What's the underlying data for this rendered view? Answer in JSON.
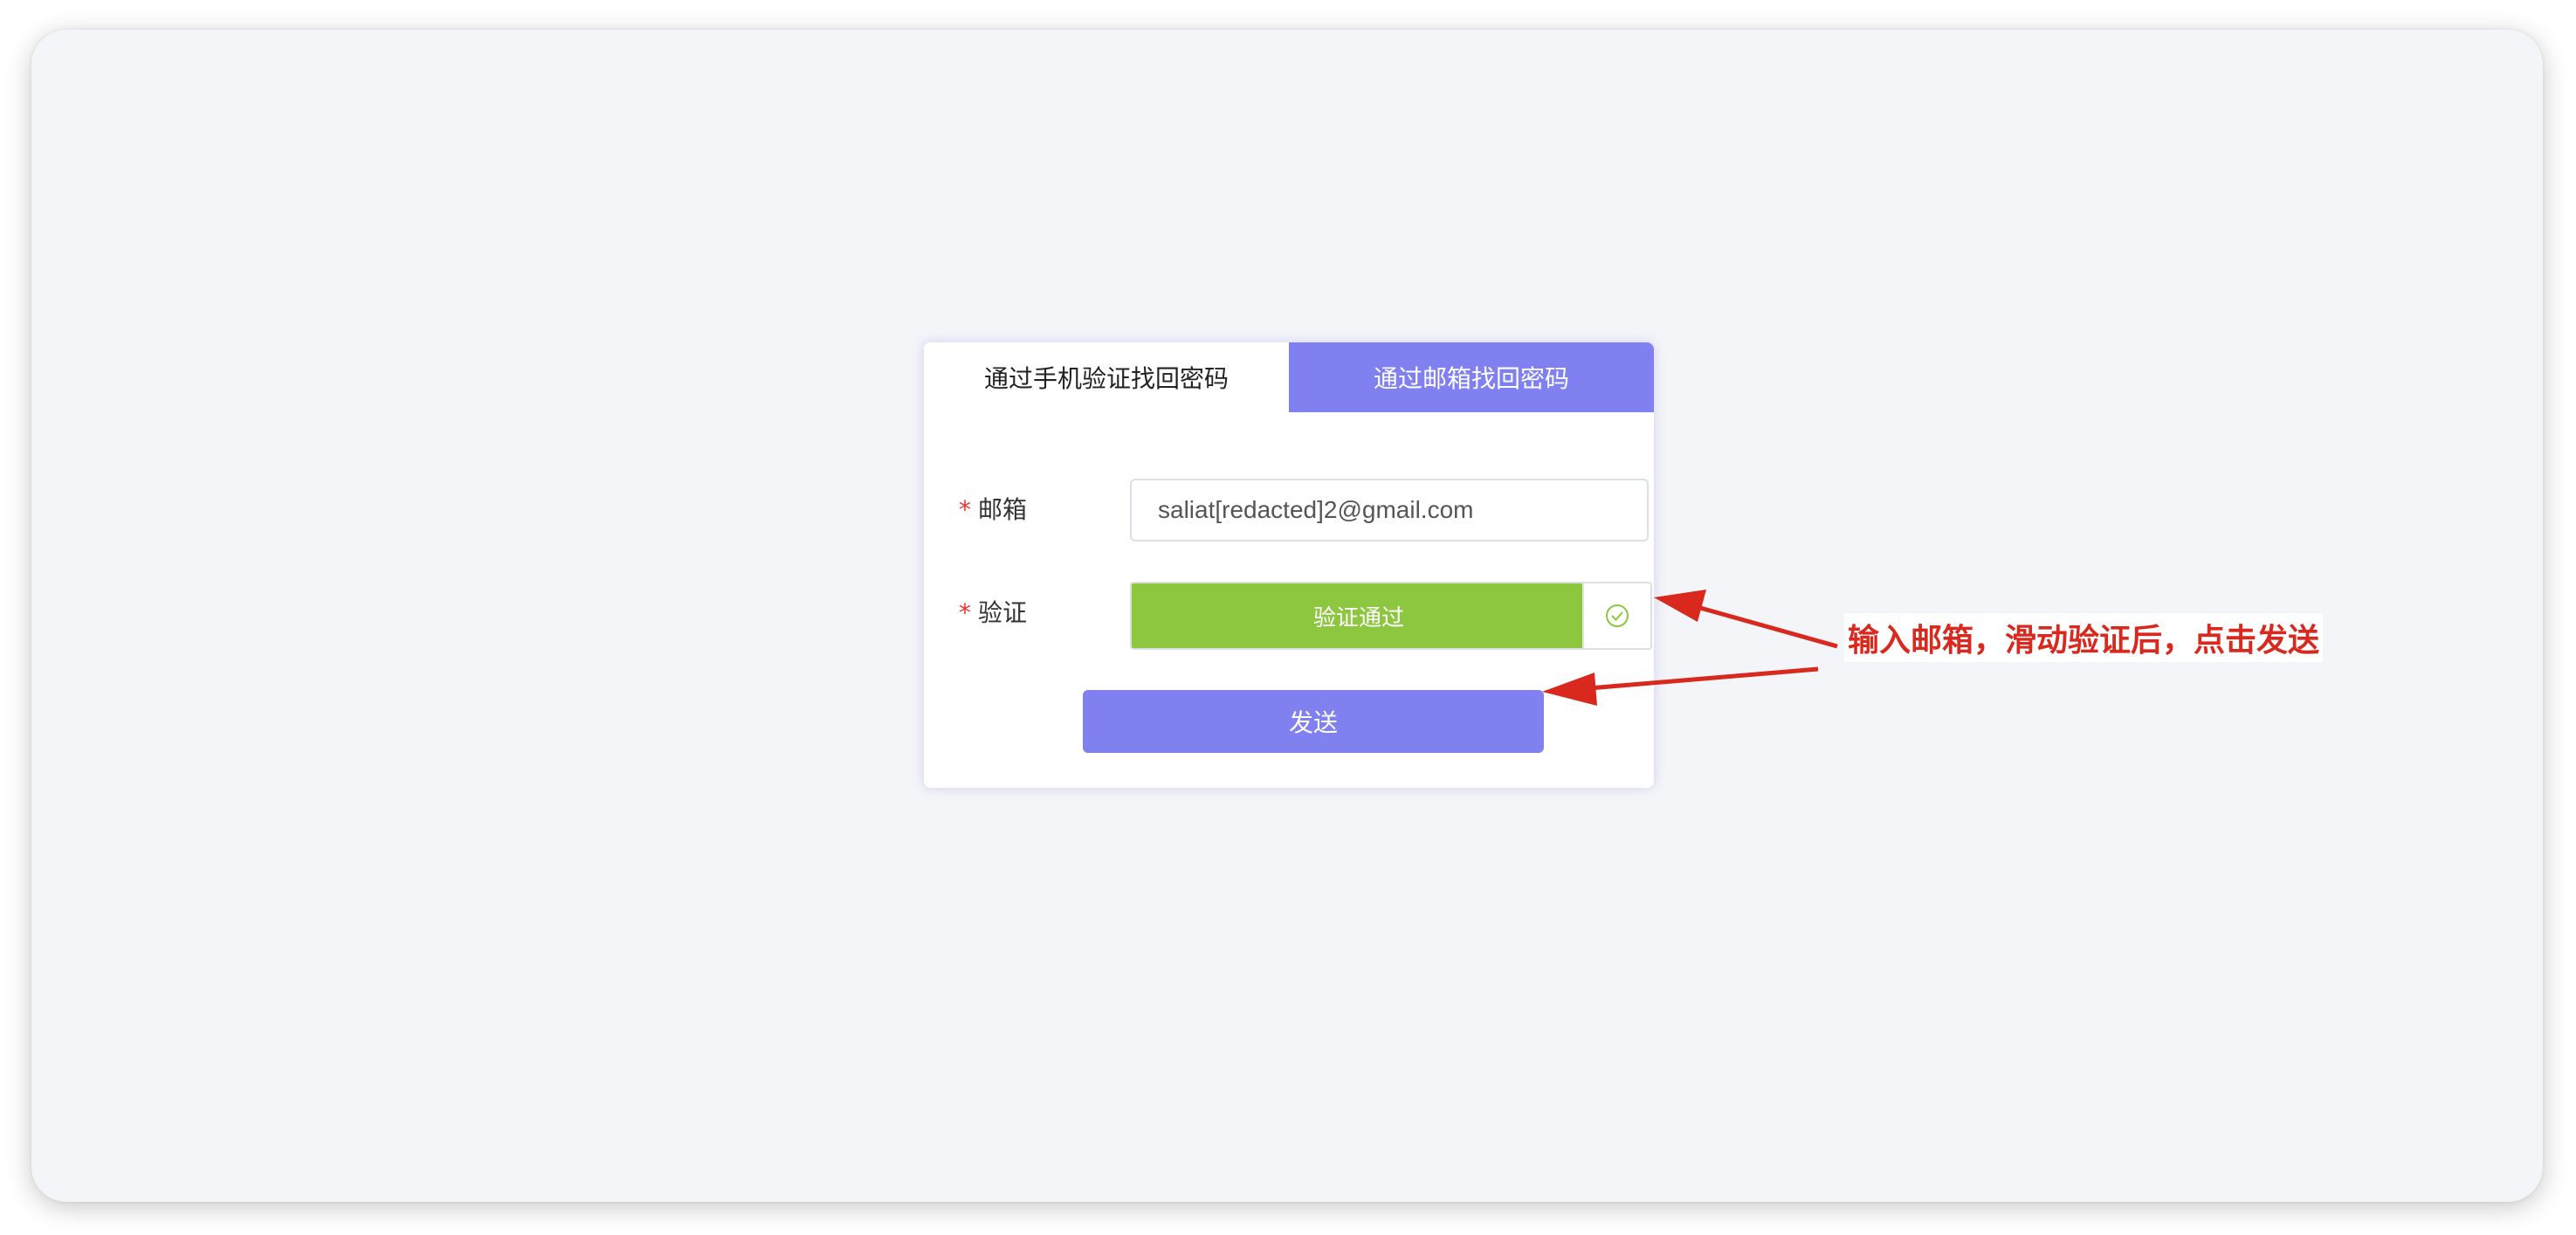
{
  "tabs": {
    "phone_label": "通过手机验证找回密码",
    "email_label": "通过邮箱找回密码",
    "active": "email"
  },
  "form": {
    "required_mark": "*",
    "email_label": "邮箱",
    "email_value": "saliat[redacted]2@gmail.com",
    "verify_label": "验证",
    "verify_status": "验证通过",
    "verify_icon": "check-circle-icon",
    "send_label": "发送"
  },
  "annotation": {
    "text": "输入邮箱，滑动验证后，点击发送"
  },
  "colors": {
    "accent": "#8080f0",
    "success": "#8dc63f",
    "annotation_red": "#d9281d",
    "background": "#f4f5f9"
  }
}
